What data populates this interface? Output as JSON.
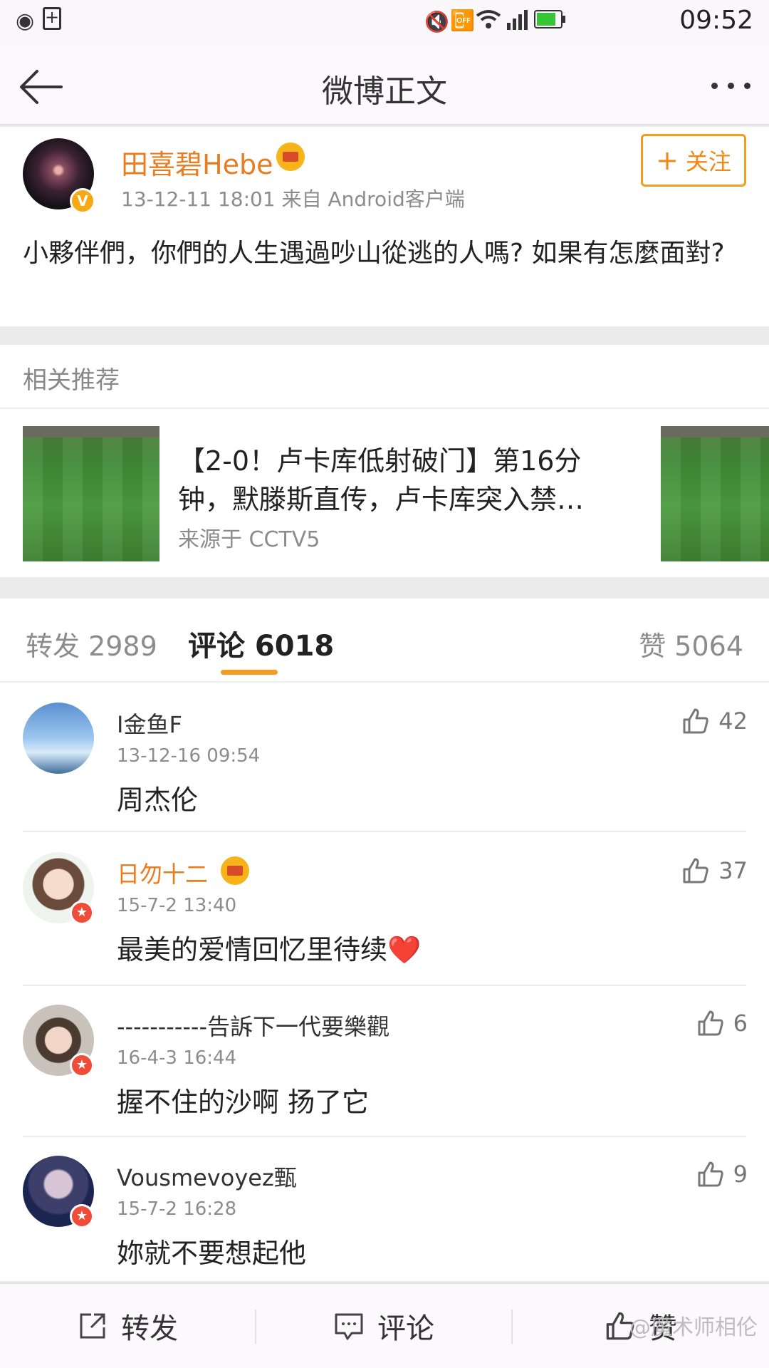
{
  "status_bar": {
    "time": "09:52"
  },
  "nav": {
    "title": "微博正文"
  },
  "post": {
    "author": "田喜碧Hebe",
    "meta": "13-12-11 18:01  来自 Android客户端",
    "follow_label": "关注",
    "text": "小夥伴們，你們的人生遇過吵山從逃的人嗎? 如果有怎麼面對?"
  },
  "related": {
    "header": "相关推荐",
    "title": "【2-0！卢卡库低射破门】第16分钟，默滕斯直传，卢卡库突入禁…",
    "source": "来源于 CCTV5"
  },
  "tabs": {
    "repost": "转发 2989",
    "comment": "评论 6018",
    "like": "赞 5064"
  },
  "comments": [
    {
      "name": "I金鱼F",
      "time": "13-12-16 09:54",
      "text": "周杰伦",
      "likes": "42"
    },
    {
      "name": "日勿十二",
      "time": "15-7-2 13:40",
      "text": "最美的爱情回忆里待续❤️",
      "likes": "37"
    },
    {
      "name": "-----------告訴下一代要樂觀",
      "time": "16-4-3 16:44",
      "text": "握不住的沙啊 扬了它",
      "likes": "6"
    },
    {
      "name": "Vousmevoyez甄",
      "time": "15-7-2 16:28",
      "text": "妳就不要想起他",
      "likes": "9"
    }
  ],
  "bottom_bar": {
    "repost": "转发",
    "comment": "评论",
    "like": "赞"
  },
  "watermark": "@魔术师相伦",
  "colors": {
    "accent": "#f39c22",
    "vip_name": "#e87c1f",
    "muted": "#8c8c8c"
  }
}
